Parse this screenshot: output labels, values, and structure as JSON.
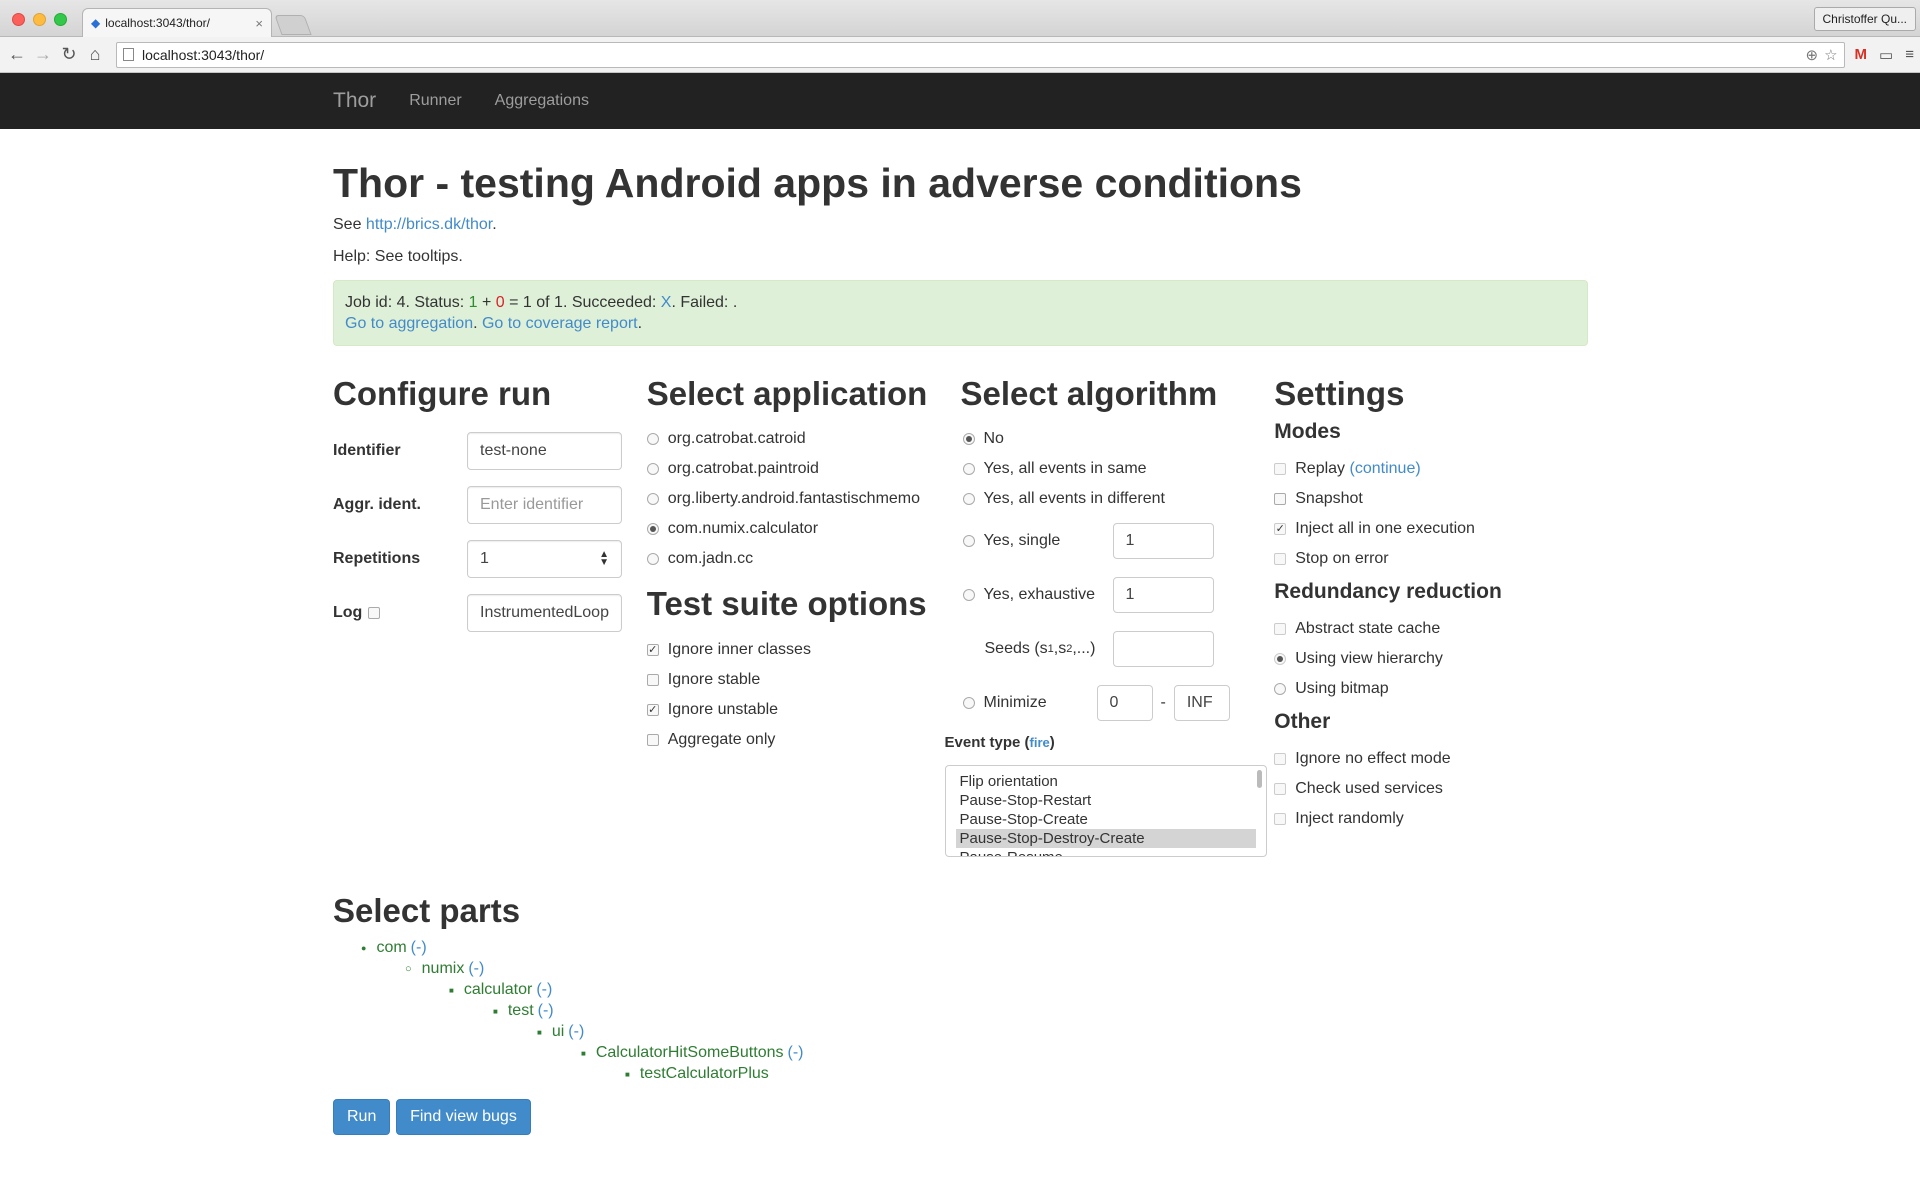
{
  "browser": {
    "tab_title": "localhost:3043/thor/",
    "close_glyph": "×",
    "profile": "Christoffer Qu...",
    "url": "localhost:3043/thor/"
  },
  "navbar": {
    "brand": "Thor",
    "links": [
      "Runner",
      "Aggregations"
    ]
  },
  "header": {
    "title": "Thor - testing Android apps in adverse conditions",
    "see_prefix": "See ",
    "see_link": "http://brics.dk/thor",
    "see_suffix": ".",
    "help": "Help: See tooltips."
  },
  "status": {
    "prefix": "Job id: 4. Status: ",
    "ok_count": "1",
    "plus": " + ",
    "fail_count": "0",
    "mid": " = 1 of 1. Succeeded: ",
    "succeeded_mark": "X",
    "failed": ". Failed: .",
    "aggregation_link": "Go to aggregation",
    "sep": ". ",
    "coverage_link": "Go to coverage report",
    "end": "."
  },
  "configure": {
    "title": "Configure run",
    "identifier_label": "Identifier",
    "identifier_value": "test-none",
    "aggr_label": "Aggr. ident.",
    "aggr_placeholder": "Enter identifier",
    "repetitions_label": "Repetitions",
    "repetitions_value": "1",
    "log_label": "Log",
    "log_value": "InstrumentedLoop"
  },
  "application": {
    "title": "Select application",
    "options": [
      {
        "label": "org.catrobat.catroid",
        "selected": false
      },
      {
        "label": "org.catrobat.paintroid",
        "selected": false
      },
      {
        "label": "org.liberty.android.fantastischmemo",
        "selected": false
      },
      {
        "label": "com.numix.calculator",
        "selected": true
      },
      {
        "label": "com.jadn.cc",
        "selected": false
      }
    ]
  },
  "suite": {
    "title": "Test suite options",
    "options": [
      {
        "label": "Ignore inner classes",
        "checked": true
      },
      {
        "label": "Ignore stable",
        "checked": false
      },
      {
        "label": "Ignore unstable",
        "checked": true
      },
      {
        "label": "Aggregate only",
        "checked": false
      }
    ]
  },
  "algorithm": {
    "title": "Select algorithm",
    "no": "No",
    "same": "Yes, all events in same",
    "different": "Yes, all events in different",
    "single": "Yes, single",
    "single_value": "1",
    "exhaustive": "Yes, exhaustive",
    "exhaustive_value": "1",
    "seeds": "Seeds (s",
    "seeds_sub1": "1",
    "seeds_mid": ",s",
    "seeds_sub2": "2",
    "seeds_end": ",...)",
    "minimize": "Minimize",
    "min_from": "0",
    "dash": "-",
    "min_to": "INF",
    "event_type_label": "Event type (",
    "event_type_link": "fire",
    "event_type_end": ")",
    "event_types": [
      "Flip orientation",
      "Pause-Stop-Restart",
      "Pause-Stop-Create",
      "Pause-Stop-Destroy-Create",
      "Pause-Resume"
    ],
    "event_selected_index": 3
  },
  "settings": {
    "title": "Settings",
    "modes_title": "Modes",
    "replay": "Replay",
    "replay_link": "(continue)",
    "snapshot": "Snapshot",
    "inject_all": "Inject all in one execution",
    "stop_on_error": "Stop on error",
    "redundancy_title": "Redundancy reduction",
    "abstract_cache": "Abstract state cache",
    "view_hierarchy": "Using view hierarchy",
    "bitmap": "Using bitmap",
    "other_title": "Other",
    "ignore_no_effect": "Ignore no effect mode",
    "check_services": "Check used services",
    "inject_randomly": "Inject randomly"
  },
  "parts": {
    "title": "Select parts",
    "tree": [
      {
        "label": "com",
        "toggle": "(-)",
        "level": 0
      },
      {
        "label": "numix",
        "toggle": "(-)",
        "level": 1
      },
      {
        "label": "calculator",
        "toggle": "(-)",
        "level": 2
      },
      {
        "label": "test",
        "toggle": "(-)",
        "level": 3
      },
      {
        "label": "ui",
        "toggle": "(-)",
        "level": 4
      },
      {
        "label": "CalculatorHitSomeButtons",
        "toggle": "(-)",
        "level": 5
      },
      {
        "label": "testCalculatorPlus",
        "toggle": "",
        "level": 6
      }
    ]
  },
  "actions": {
    "run": "Run",
    "find_view_bugs": "Find view bugs"
  }
}
